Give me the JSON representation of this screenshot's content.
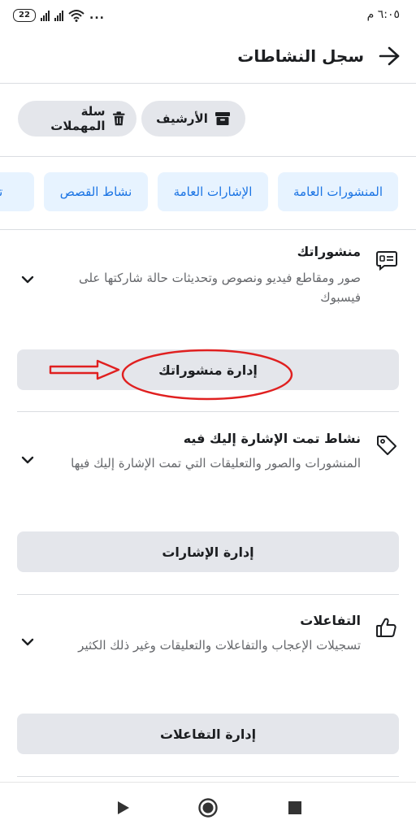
{
  "status_bar": {
    "time": "٦:٠٥ م",
    "battery": "22",
    "more": "..."
  },
  "header": {
    "title": "سجل النشاطات"
  },
  "chips": {
    "archive": "الأرشيف",
    "trash": "سلة المهملات"
  },
  "tabs": [
    "المنشورات العامة",
    "الإشارات العامة",
    "نشاط القصص",
    "تس"
  ],
  "sections": [
    {
      "title": "منشوراتك",
      "description": "صور ومقاطع فيديو ونصوص وتحديثات حالة شاركتها على فيسبوك",
      "button": "إدارة منشوراتك",
      "icon": "posts-icon"
    },
    {
      "title": "نشاط تمت الإشارة إليك فيه",
      "description": "المنشورات والصور والتعليقات التي تمت الإشارة إليك فيها",
      "button": "إدارة الإشارات",
      "icon": "tag-icon"
    },
    {
      "title": "التفاعلات",
      "description": "تسجيلات الإعجاب والتفاعلات والتعليقات وغير ذلك الكثير",
      "button": "إدارة التفاعلات",
      "icon": "thumbs-up-icon"
    }
  ],
  "colors": {
    "tab_bg": "#e7f3ff",
    "tab_text": "#1b74e4",
    "button_bg": "#e4e6eb",
    "annotation": "#e02020"
  }
}
